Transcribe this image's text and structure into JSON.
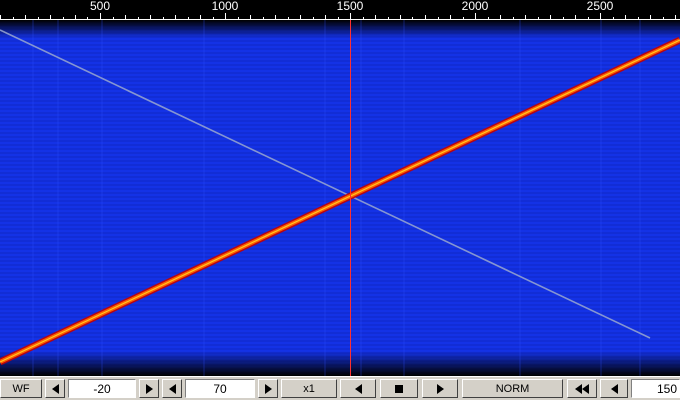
{
  "ruler": {
    "ticks": [
      "500",
      "1000",
      "1500",
      "2000",
      "2500"
    ],
    "tick_values": [
      500,
      1000,
      1500,
      2000,
      2500
    ],
    "range": [
      100,
      2820
    ],
    "cursor_value": 1500
  },
  "waterfall": {
    "background_color": "#1432e6",
    "cursor_color": "#ff3030",
    "strong_trace": {
      "start_value": 100,
      "end_value": 2820,
      "colors": [
        "#ffe030",
        "#ff6000",
        "#c80000"
      ]
    },
    "weak_trace": {
      "start_value": 100,
      "end_value": 2700,
      "color": "#9aa8d0"
    }
  },
  "toolbar": {
    "mode_label": "WF",
    "min_value": "-20",
    "range_value": "70",
    "zoom_label": "x1",
    "speed_label": "NORM",
    "offset_value": "150"
  },
  "icons": [
    "left-arrow-icon",
    "right-arrow-icon",
    "stop-icon",
    "rewind-icon"
  ]
}
